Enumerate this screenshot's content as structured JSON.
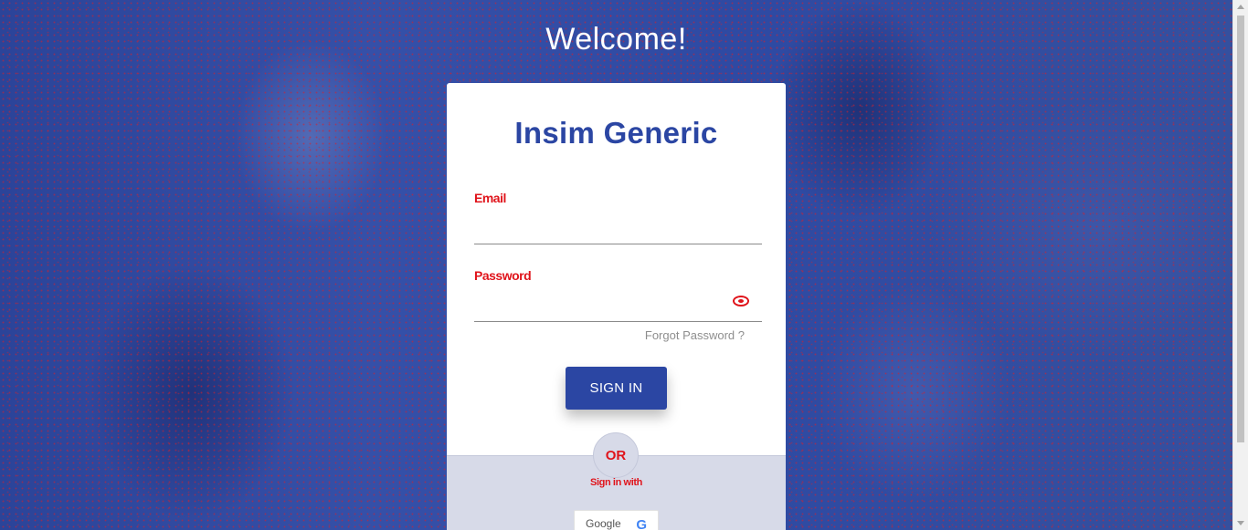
{
  "page": {
    "welcome": "Welcome!"
  },
  "card": {
    "title": "Insim Generic",
    "email_label": "Email",
    "email_value": "",
    "password_label": "Password",
    "password_value": "",
    "forgot_password": "Forgot Password ?",
    "signin_button": "SIGN IN",
    "or_label": "OR",
    "signin_with": "Sign in with",
    "google_button": "Google",
    "google_icon_glyph": "G",
    "password_toggle_icon": "eye-icon",
    "google_icon": "google-icon"
  },
  "colors": {
    "brand_blue": "#2b46a3",
    "accent_red": "#e0141b",
    "bottom_panel": "#d7dae8"
  }
}
